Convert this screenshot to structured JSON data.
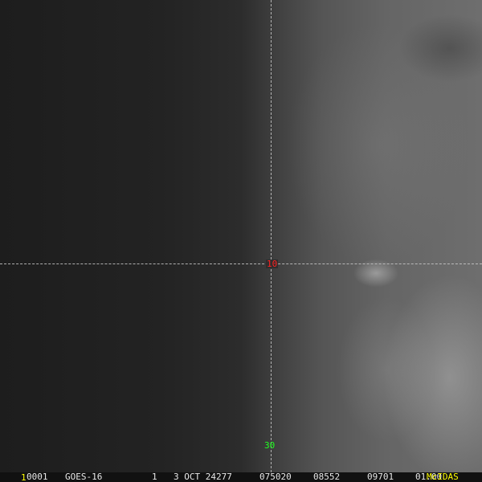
{
  "grid_labels": {
    "latitude": "10",
    "longitude": "30"
  },
  "status_bar": {
    "frame_number": "1",
    "image_id": "0001",
    "satellite": "GOES-16",
    "band": "1",
    "date": "3 OCT 24277",
    "time": "075020",
    "lat_value": "08552",
    "lon_value": "09701",
    "resolution": "01.00",
    "brand": "McIDAS"
  },
  "colors": {
    "grid": "#c8c8c8",
    "lat_label": "#ff2020",
    "lon_label": "#20ff20",
    "frame_number": "#ffff00",
    "brand": "#ffff00"
  }
}
